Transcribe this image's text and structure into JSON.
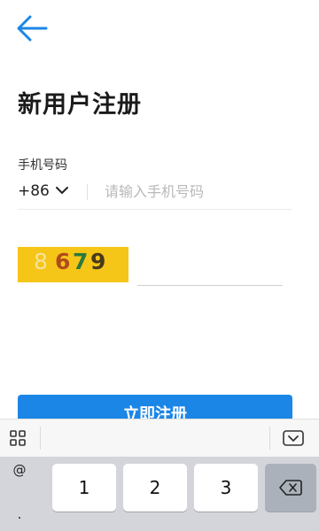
{
  "header": {
    "back_icon": "arrow-left-icon",
    "accent": "#1c86e6"
  },
  "page_title": "新用户注册",
  "phone": {
    "label": "手机号码",
    "country_code": "+86",
    "placeholder": "请输入手机号码"
  },
  "captcha": {
    "chars": [
      "8",
      "6",
      "7",
      "9"
    ],
    "background": "#f5c518",
    "input_value": ""
  },
  "register_button": {
    "label": "立即注册",
    "color": "#1c86e6"
  },
  "keyboard": {
    "toolbar": {
      "left_icon": "grid-icon",
      "right_icon": "keyboard-collapse-icon"
    },
    "symbols": [
      "@",
      "."
    ],
    "keys": [
      "1",
      "2",
      "3"
    ],
    "backspace_icon": "backspace-icon"
  }
}
